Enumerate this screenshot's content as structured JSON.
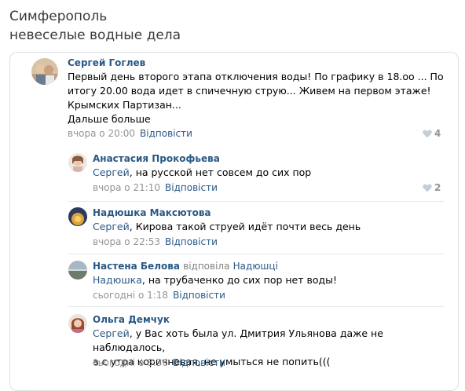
{
  "header": {
    "line1": "Симферополь",
    "line2": "невеселые водные дела"
  },
  "colors": {
    "link": "#2a5885",
    "meta": "#939393",
    "divider": "#e7e8ec"
  },
  "comments": [
    {
      "author": "Сергей Гоглев",
      "text_lines": [
        "Первый день второго этапа отключения воды! По графику в 18.оо ... По",
        "итогу 20.00 вода идет в спичечную струю... Живем на первом этаже!",
        "Крымских Партизан...",
        "Дальше больше"
      ],
      "time": "вчора о 20:00",
      "reply_label": "Відповісти",
      "likes": "4"
    },
    {
      "author": "Анастасия Прокофьева",
      "mention": "Сергей",
      "text": ", на русской нет совсем до сих пор",
      "time": "вчора о 21:10",
      "reply_label": "Відповісти",
      "likes": "2"
    },
    {
      "author": "Надюшка Максютова",
      "mention": "Сергей",
      "text": ", Кирова такой струей идёт почти весь день",
      "time": "вчора о 22:53",
      "reply_label": "Відповісти"
    },
    {
      "author": "Настена Белова",
      "replied_word": "відповіла",
      "replied_to": "Надюшці",
      "mention": "Надюшка",
      "text": ", на трубаченко до сих пор нет воды!",
      "time": "сьогодні о 1:18",
      "reply_label": "Відповісти"
    },
    {
      "author": "Ольга Демчук",
      "mention": "Сергей",
      "text_line1": ", у Вас хоть была ул. Дмитрия Ульянова даже не наблюдалось,",
      "text_line2": "а с утра коричневая, не умыться не попить(((",
      "time": "сьогодні о 8:36",
      "reply_label": "Відповісти"
    }
  ]
}
